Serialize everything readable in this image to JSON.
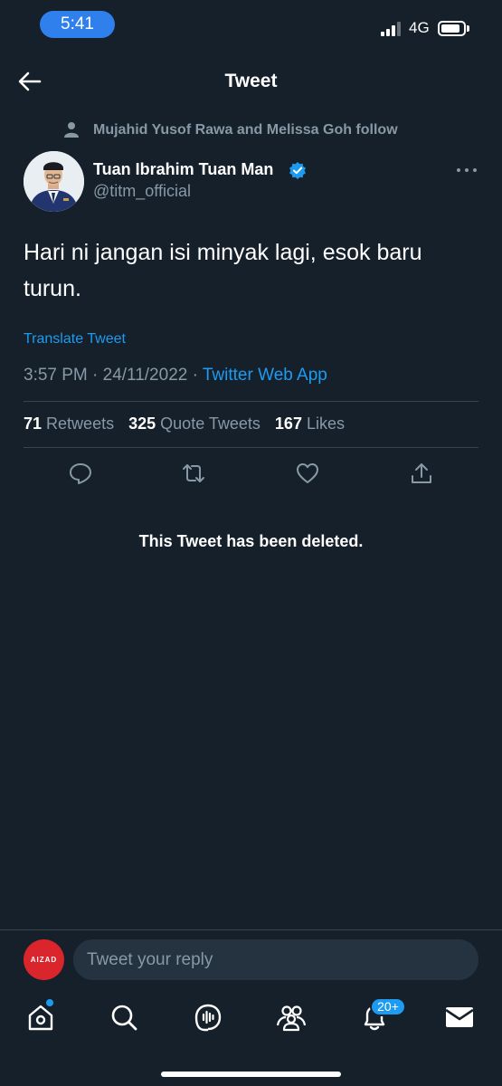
{
  "status_bar": {
    "time": "5:41",
    "network": "4G",
    "signal_bars": 3,
    "battery_fraction": 0.85
  },
  "header": {
    "title": "Tweet",
    "back_icon": "arrow-left-icon"
  },
  "social_context": {
    "icon": "person-icon",
    "text": "Mujahid Yusof Rawa and Melissa Goh follow"
  },
  "tweet": {
    "author_name": "Tuan Ibrahim Tuan Man",
    "author_handle": "@titm_official",
    "verified": true,
    "text": "Hari ni jangan isi minyak lagi, esok baru turun.",
    "translate_label": "Translate Tweet",
    "timestamp": "3:57 PM · 24/11/2022 · ",
    "source": "Twitter Web App",
    "stats": {
      "retweets_count": "71",
      "retweets_label": "Retweets",
      "quotes_count": "325",
      "quotes_label": "Quote Tweets",
      "likes_count": "167",
      "likes_label": "Likes"
    }
  },
  "deleted_notice": "This Tweet has been deleted.",
  "reply": {
    "avatar_text": "AIZAD",
    "placeholder": "Tweet your reply"
  },
  "tab_bar": {
    "tabs": [
      "home-icon",
      "search-icon",
      "spaces-icon",
      "communities-icon",
      "notifications-icon",
      "messages-icon"
    ],
    "notifications_badge": "20+"
  },
  "colors": {
    "background": "#15202b",
    "accent": "#1d9bf0",
    "secondary_text": "#8899a6",
    "divider": "#38444d"
  }
}
